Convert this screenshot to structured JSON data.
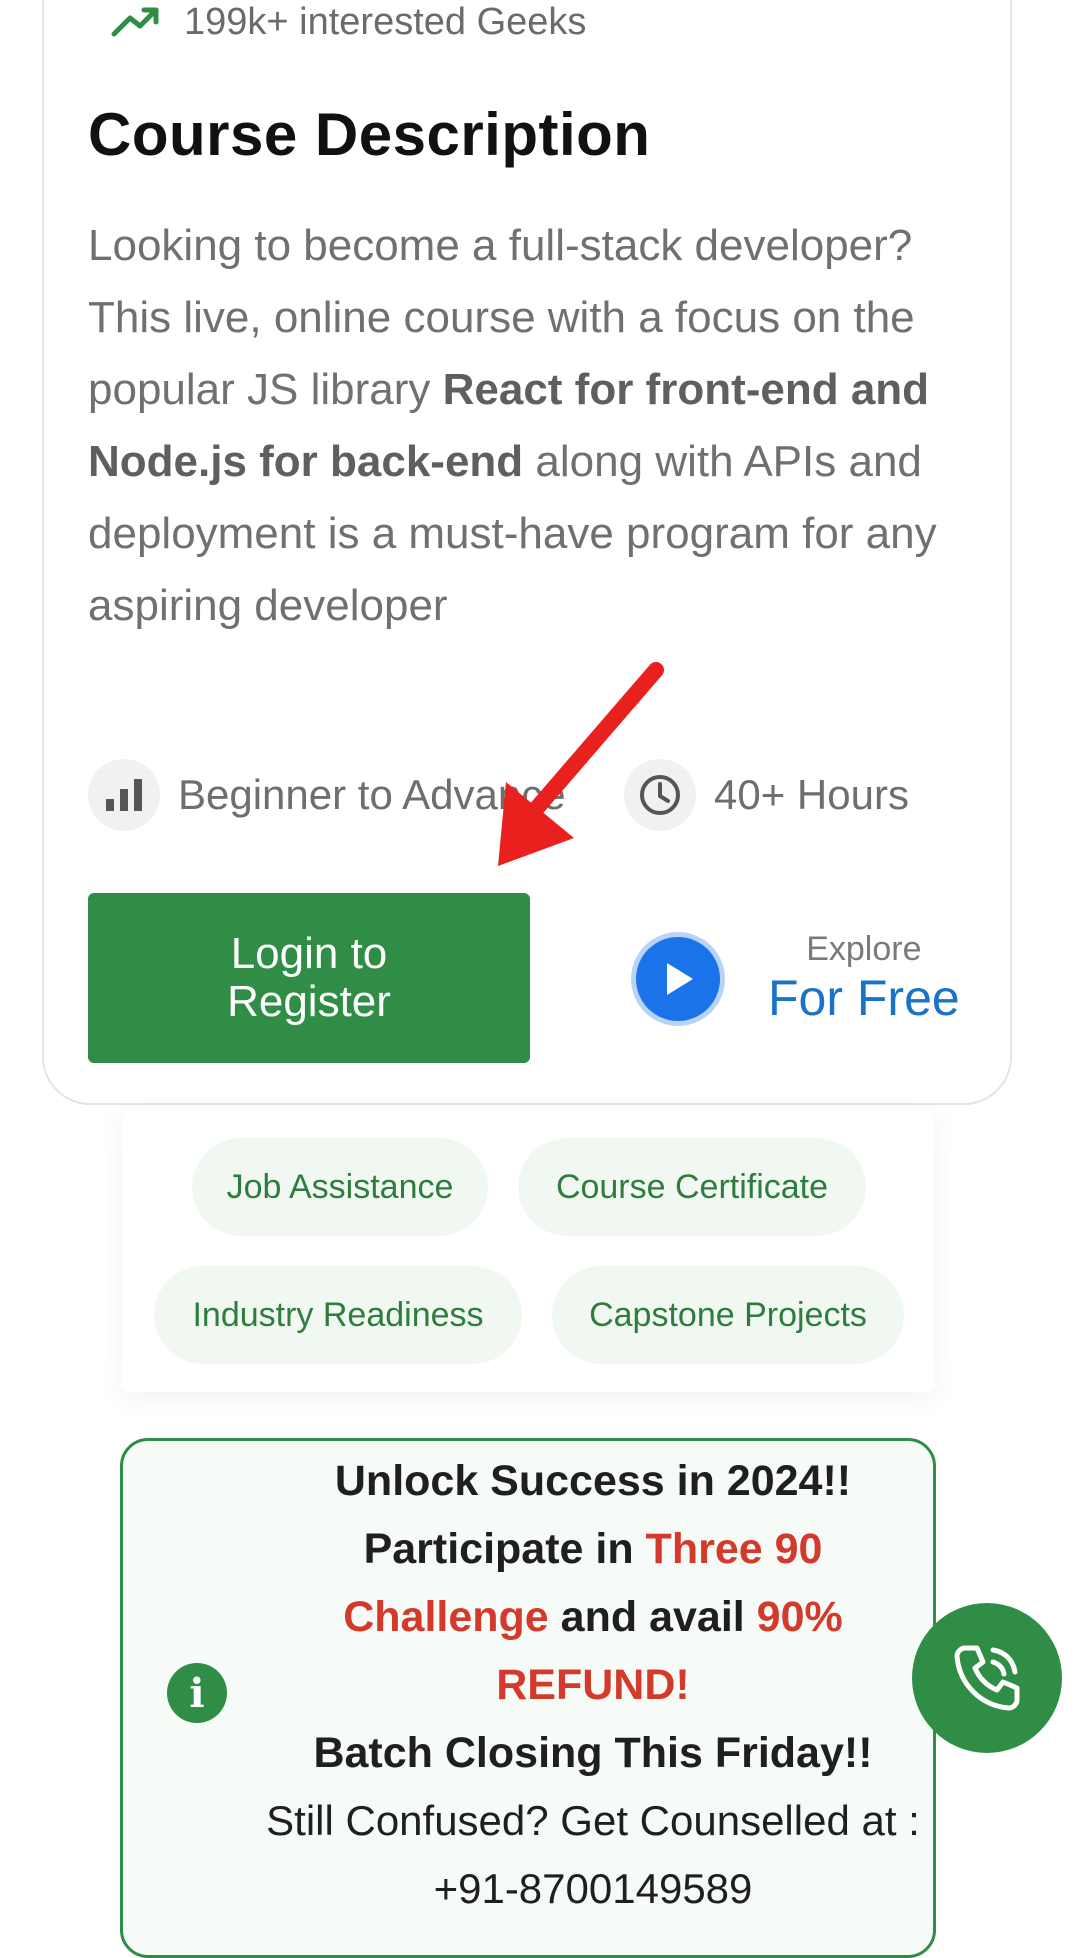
{
  "header": {
    "interest_text": "199k+ interested Geeks",
    "interest_icon": "trending-up-icon"
  },
  "course": {
    "title": "Course Description",
    "description_part1": "Looking to become a full-stack developer? This live, online course with a focus on the popular JS library ",
    "description_bold": "React for front-end and Node.js for back-end",
    "description_part2": " along with APIs and deployment is a must-have program for any aspiring developer",
    "level": "Beginner to Advance",
    "level_icon": "bar-chart-icon",
    "duration": "40+ Hours",
    "duration_icon": "clock-icon"
  },
  "actions": {
    "login_label_line1": "Login to",
    "login_label_line2": "Register",
    "explore_small": "Explore",
    "explore_big": "For Free",
    "play_icon": "play-icon"
  },
  "tags": [
    "Job Assistance",
    "Course Certificate",
    "Industry Readiness",
    "Capstone Projects"
  ],
  "notice": {
    "line1": "Unlock Success in 2024!!",
    "participate": "Participate in ",
    "challenge": "Three 90 Challenge",
    "avail": " and avail ",
    "refund": "90% REFUND!",
    "closing": "Batch Closing This Friday!!",
    "counsel": "Still Confused? Get Counselled at : +91-8700149589",
    "info_icon": "info-icon"
  },
  "fab": {
    "icon": "phone-call-icon"
  },
  "annotation": {
    "icon": "red-arrow-icon"
  },
  "colors": {
    "brand_green": "#2f8d46",
    "accent_blue": "#1a73c8",
    "highlight_red": "#d33a2c",
    "tag_bg": "#f1f8f2"
  }
}
